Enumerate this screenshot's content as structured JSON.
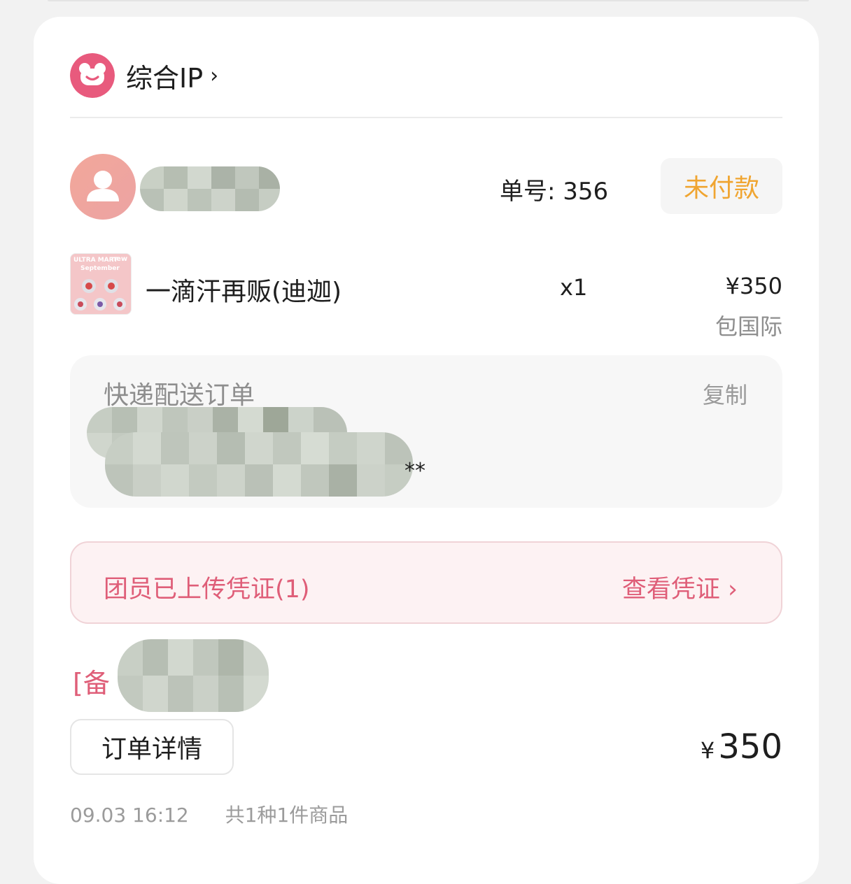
{
  "shop": {
    "name": "综合IP",
    "chevron": "›",
    "logo_icon": "bear-logo-icon"
  },
  "buyer": {
    "name_visible": "元咨",
    "avatar_icon": "user-avatar-icon"
  },
  "order": {
    "number_label": "单号:",
    "number_value": "356",
    "status": "未付款"
  },
  "product": {
    "name": "一滴汗再贩(迪迦)",
    "quantity": "x1",
    "price": "¥350",
    "shipping": "包国际",
    "thumb_title": "ULTRA MART",
    "thumb_subtitle": "September",
    "thumb_tag": "new"
  },
  "delivery": {
    "title": "快递配送订单",
    "copy_label": "复制",
    "address_tail": "**"
  },
  "voucher": {
    "text": "团员已上传凭证(1)",
    "link": "查看凭证",
    "chevron": "›"
  },
  "remark": {
    "prefix": "[备"
  },
  "footer": {
    "detail_button": "订单详情",
    "total_currency": "¥",
    "total_amount": "350",
    "time": "09.03 16:12",
    "summary": "共1种1件商品"
  },
  "colors": {
    "accent_pink": "#df5e78",
    "status_orange": "#f0a531",
    "logo_pink": "#e85a7d"
  }
}
